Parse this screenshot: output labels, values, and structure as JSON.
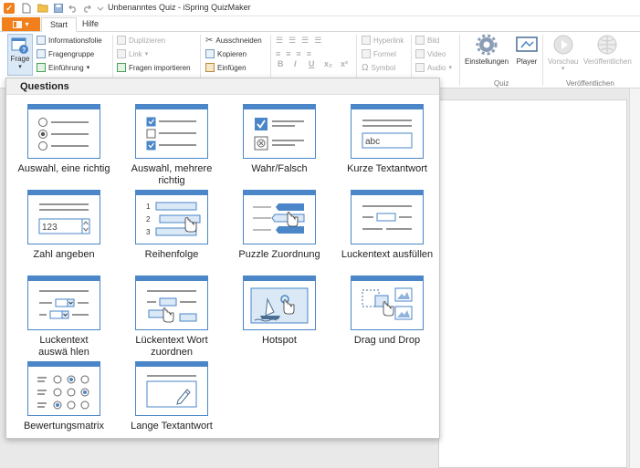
{
  "window": {
    "title": "Unbenanntes Quiz - iSpring QuizMaker"
  },
  "tabs": [
    {
      "label": "Start"
    },
    {
      "label": "Hilfe"
    }
  ],
  "ribbon": {
    "frage_label": "Frage",
    "insert": {
      "informationsfolie": "Informationsfolie",
      "fragengruppe": "Fragengruppe",
      "einfuehrung": "Einführung"
    },
    "duplicate": {
      "duplizieren": "Duplizieren",
      "link": "Link",
      "fragen_importieren": "Fragen importieren"
    },
    "clipboard": {
      "ausschneiden": "Ausschneiden",
      "kopieren": "Kopieren",
      "einfuegen": "Einfügen"
    },
    "format": {
      "bold": "B",
      "italic": "I",
      "underline": "U",
      "sub": "x₂",
      "sup": "x²"
    },
    "insert_media": {
      "hyperlink": "Hyperlink",
      "formel": "Formel",
      "symbol": "Symbol",
      "bild": "Bild",
      "video": "Video",
      "audio": "Audio"
    },
    "quiz": {
      "einstellungen": "Einstellungen",
      "player": "Player",
      "group_label": "Quiz"
    },
    "publish": {
      "vorschau": "Vorschau",
      "veroeffentlichen": "Veröffentlichen",
      "group_label": "Veröffentlichen"
    }
  },
  "questions_panel": {
    "header": "Questions",
    "items": [
      {
        "label": "Auswahl, eine richtig",
        "icon": "single-choice-icon"
      },
      {
        "label": "Auswahl, mehrere richtig",
        "icon": "multiple-choice-icon"
      },
      {
        "label": "Wahr/Falsch",
        "icon": "true-false-icon"
      },
      {
        "label": "Kurze Textantwort",
        "icon": "short-answer-icon",
        "sample": "abc"
      },
      {
        "label": "Zahl angeben",
        "icon": "numeric-icon",
        "sample": "123"
      },
      {
        "label": "Reihenfolge",
        "icon": "sequence-icon",
        "numbers": [
          "1",
          "2",
          "3"
        ]
      },
      {
        "label": "Puzzle Zuordnung",
        "icon": "matching-icon"
      },
      {
        "label": "Luckentext ausfüllen",
        "icon": "fill-in-blanks-icon"
      },
      {
        "label": "Luckentext auswä hlen",
        "icon": "select-from-lists-icon"
      },
      {
        "label": "Lückentext Wort zuordnen",
        "icon": "drag-words-icon"
      },
      {
        "label": "Hotspot",
        "icon": "hotspot-icon"
      },
      {
        "label": "Drag und Drop",
        "icon": "drag-and-drop-icon"
      },
      {
        "label": "Bewertungsmatrix",
        "icon": "likert-scale-icon"
      },
      {
        "label": "Lange Textantwort",
        "icon": "essay-icon"
      }
    ]
  },
  "colors": {
    "accent": "#4a86c8",
    "file_tab": "#f07f1c",
    "light_blue": "#dbe8f6"
  }
}
